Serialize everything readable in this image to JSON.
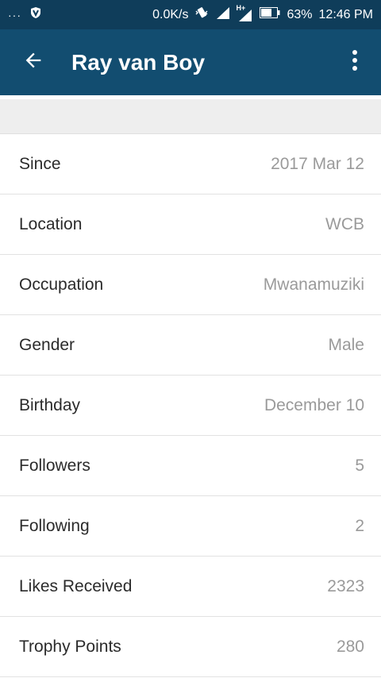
{
  "status_bar": {
    "dots": "···",
    "net_speed": "0.0K/s",
    "network_type": "H+",
    "battery": "63%",
    "time": "12:46 PM",
    "icons": [
      "shield-v-icon",
      "vibrate-icon",
      "signal-icon",
      "signal-hplus-icon",
      "battery-icon"
    ]
  },
  "appbar": {
    "title": "Ray van Boy",
    "back_icon": "arrow-left-icon",
    "menu_icon": "more-vertical-icon",
    "color": "#124d70"
  },
  "profile": {
    "rows": [
      {
        "label": "Since",
        "value": "2017 Mar 12"
      },
      {
        "label": "Location",
        "value": "WCB"
      },
      {
        "label": "Occupation",
        "value": "Mwanamuziki"
      },
      {
        "label": "Gender",
        "value": "Male"
      },
      {
        "label": "Birthday",
        "value": "December 10"
      },
      {
        "label": "Followers",
        "value": "5"
      },
      {
        "label": "Following",
        "value": "2"
      },
      {
        "label": "Likes Received",
        "value": "2323"
      },
      {
        "label": "Trophy Points",
        "value": "280"
      }
    ]
  }
}
